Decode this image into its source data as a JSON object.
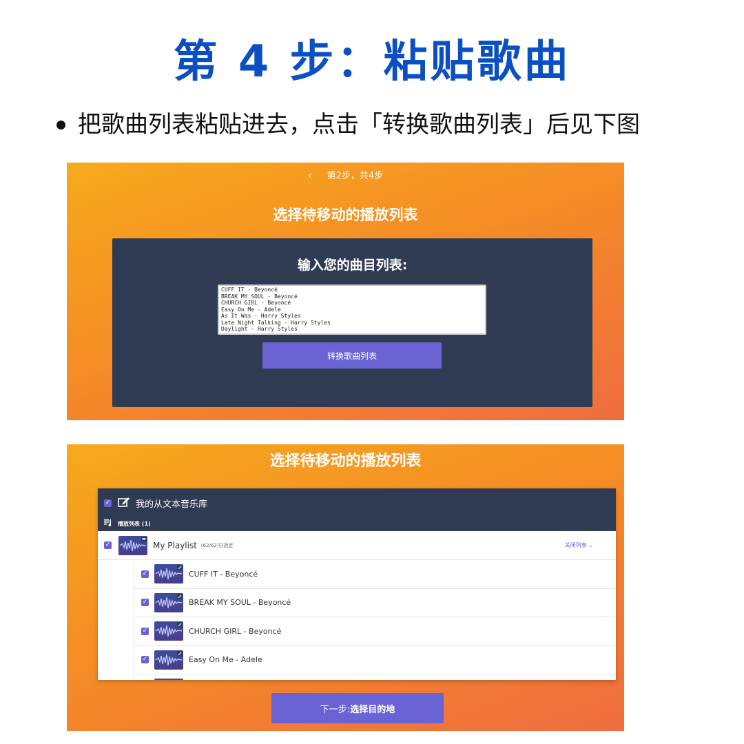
{
  "page": {
    "title": "第 4 步：粘贴歌曲",
    "instruction": "把歌曲列表粘贴进去，点击「转换歌曲列表」后见下图"
  },
  "step_panel": {
    "nav_back_icon": "‹",
    "step_text": "第2步，共4步",
    "heading": "选择待移动的播放列表",
    "card_title": "输入您的曲目列表:",
    "textarea_value": "CUFF IT - Beyoncé\nBREAK MY SOUL - Beyoncé\nCHURCH GIRL - Beyoncé\nEasy On Me - Adele\nAs It Was - Harry Styles\nLate Night Talking - Harry Styles\nDaylight - Harry Styles\nWPS - Hardwick Lanes",
    "convert_button": "转换歌曲列表"
  },
  "result_panel": {
    "heading": "选择待移动的播放列表",
    "library_title": "我的从文本音乐库",
    "playlists_label": "播放列表 (1)",
    "playlist": {
      "name": "My Playlist",
      "count": "(62/62)已选定",
      "close_label": "关闭列表"
    },
    "tracks": [
      "CUFF IT - Beyoncé",
      "BREAK MY SOUL - Beyoncé",
      "CHURCH GIRL - Beyoncé",
      "Easy On Me - Adele"
    ],
    "next_button_prefix": "下一步: ",
    "next_button_bold": "选择目的地"
  },
  "colors": {
    "title_blue": "#0a4fc4",
    "accent_purple": "#6a63d4",
    "card_dark": "#2e3b52",
    "gradient_orange": "#f58d25"
  }
}
